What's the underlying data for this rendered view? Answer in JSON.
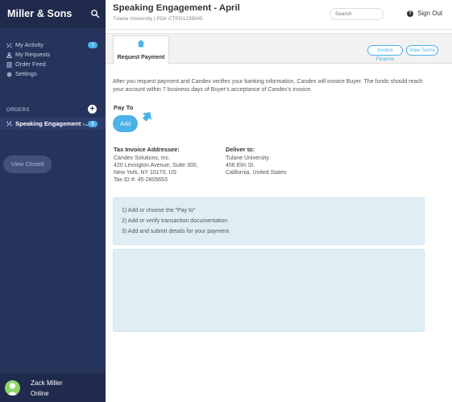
{
  "sidebar": {
    "brand": "Miller & Sons",
    "nav": [
      {
        "label": "My Activity",
        "badge": "1"
      },
      {
        "label": "My Requests"
      },
      {
        "label": "Order Feed"
      },
      {
        "label": "Settings"
      }
    ],
    "orders_heading": "ORDERS",
    "add_order_symbol": "+",
    "order_item": {
      "label": "Speaking Engagement -...",
      "badge": "1"
    },
    "view_closed_label": "View Closed",
    "user": {
      "name": "Zack Miller",
      "status": "Online"
    }
  },
  "header": {
    "title": "Speaking Engagement - April",
    "subtitle": "Tulane University | PO# CTPO1239045",
    "search_placeholder": "Search",
    "help_symbol": "?",
    "sign_out_label": "Sign Out"
  },
  "tabs": [
    {
      "label": "Request Payment",
      "icon": "home-icon",
      "active": true
    }
  ],
  "actions": {
    "invoice_finance_label": "Invoice Finance",
    "view_terms_label": "View Terms"
  },
  "main": {
    "intro": "After you request payment and Candex verifies your banking information, Candex will invoice Buyer. The funds should reach your account within 7 business days of Buyer's acceptance of Candex's invoice.",
    "pay_to_label": "Pay To",
    "add_button_label": "Add",
    "tax_invoice": {
      "heading": "Tax Invoice Addressee:",
      "lines": [
        "Candex Solutions, Inc.",
        "420 Lexington Avenue, Suite 300,",
        "New York, NY 10170, US",
        "Tax ID #: 45-2805653"
      ]
    },
    "deliver_to": {
      "heading": "Deliver to:",
      "lines": [
        "Tulane University",
        "456 Elm St.",
        "California, United States"
      ]
    },
    "steps": [
      "1)  Add or choose the \"Pay to\"",
      "2)  Add or verify transaction documentation",
      "3)  Add and submit details for your payment"
    ]
  },
  "colors": {
    "sidebar": "#26335b",
    "sidebar_dark": "#1f2a4d",
    "accent": "#4ab1e9",
    "panel": "#dfeef4"
  }
}
